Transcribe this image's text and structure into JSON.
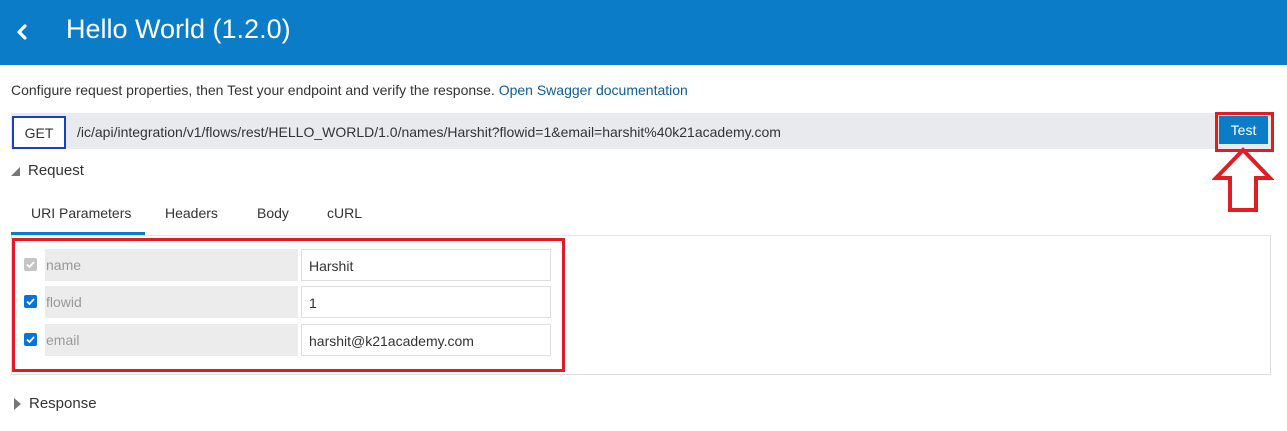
{
  "header": {
    "title": "Hello World (1.2.0)",
    "back_icon": "chevron-left-icon"
  },
  "intro": {
    "text": "Configure request properties, then Test your endpoint and verify the response. ",
    "link": "Open Swagger documentation"
  },
  "endpoint": {
    "method": "GET",
    "url": "/ic/api/integration/v1/flows/rest/HELLO_WORLD/1.0/names/Harshit?flowid=1&email=harshit%40k21academy.com",
    "test_label": "Test"
  },
  "request": {
    "label": "Request",
    "tabs": [
      "URI Parameters",
      "Headers",
      "Body",
      "cURL"
    ],
    "active_tab": "URI Parameters",
    "params": [
      {
        "name": "name",
        "value": "Harshit",
        "checked": true,
        "disabled": true
      },
      {
        "name": "flowid",
        "value": "1",
        "checked": true,
        "disabled": false
      },
      {
        "name": "email",
        "value": "harshit@k21academy.com",
        "checked": true,
        "disabled": false
      }
    ]
  },
  "response": {
    "label": "Response"
  },
  "colors": {
    "header_bg": "#0a7cc8",
    "annotation_red": "#e31b23",
    "method_border": "#1c3fbe",
    "link": "#0a5d9c"
  }
}
